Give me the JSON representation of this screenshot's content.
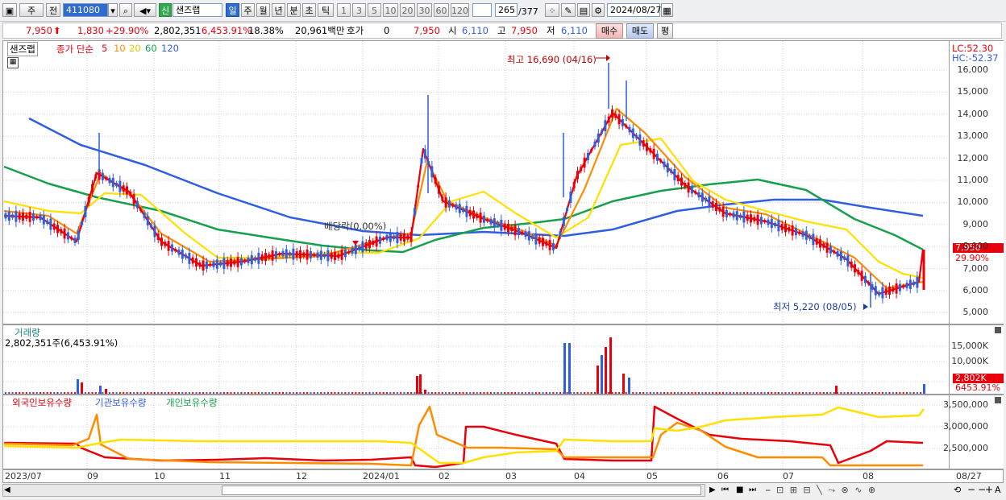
{
  "toolbar": {
    "market_type": "주",
    "prev_label": "전",
    "code": "411080",
    "new_badge": "신",
    "stock_name": "샌즈랩",
    "periods": [
      "일",
      "주",
      "월",
      "년",
      "분",
      "초",
      "틱"
    ],
    "period_selected": "일",
    "intervals": [
      "1",
      "3",
      "5",
      "10",
      "20",
      "30",
      "60",
      "120"
    ],
    "page_current": "265",
    "page_total": "/377",
    "date": "2024/08/27"
  },
  "quote": {
    "price": "7,950",
    "change": "1,830",
    "change_pct": "+29.90%",
    "volume": "2,802,351",
    "volume_pct": "6,453.91%",
    "turnover": "18.38%",
    "amount": "20,961백만",
    "hoga_label": "호가",
    "hoga_value": "0",
    "hoga_price": "7,950",
    "open_label": "시",
    "open": "6,110",
    "high_label": "고",
    "high": "7,950",
    "low_label": "저",
    "low": "6,110",
    "buy_label": "매수",
    "sell_label": "매도",
    "eval_label": "평"
  },
  "price_panel": {
    "title": "샌즈랩",
    "legend_prefix": "종가 단순",
    "ma_periods": [
      "5",
      "10",
      "20",
      "60",
      "120"
    ],
    "ma_colors": [
      "#e8000b",
      "#ff8c00",
      "#ffe000",
      "#16a04b",
      "#2f5fe0"
    ],
    "lc": "LC:52.30",
    "hc": "HC:-52.37",
    "high_annotation": "최고 16,690 (04/16)",
    "low_annotation": "최저 5,220 (08/05)",
    "dividend_annotation": "배당락(0.00%)",
    "last_price_tag": "7,950",
    "last_change_tag": "29.90%",
    "y_ticks": [
      "16,000",
      "15,000",
      "14,000",
      "13,000",
      "12,000",
      "11,000",
      "10,000",
      "9,000",
      "8,000",
      "7,000",
      "6,000",
      "5,000"
    ]
  },
  "volume_panel": {
    "title": "거래량",
    "subtitle": "2,802,351주(6,453.91%)",
    "y_ticks": [
      "15,000K",
      "10,000K"
    ],
    "last_tag": "2,802K",
    "last_pct": "6453.91%"
  },
  "holding_panel": {
    "series": [
      "외국인보유수량",
      "기관보유수량",
      "개인보유수량"
    ],
    "colors": [
      "#e8000b",
      "#2f5fe0",
      "#16a04b"
    ],
    "y_ticks": [
      "3,500,000",
      "3,000,000",
      "2,500,000"
    ]
  },
  "x_axis": {
    "labels": [
      "2023/07",
      "09",
      "10",
      "11",
      "12",
      "2024/01",
      "02",
      "03",
      "04",
      "05",
      "06",
      "07",
      "08",
      "08/27"
    ]
  }
}
